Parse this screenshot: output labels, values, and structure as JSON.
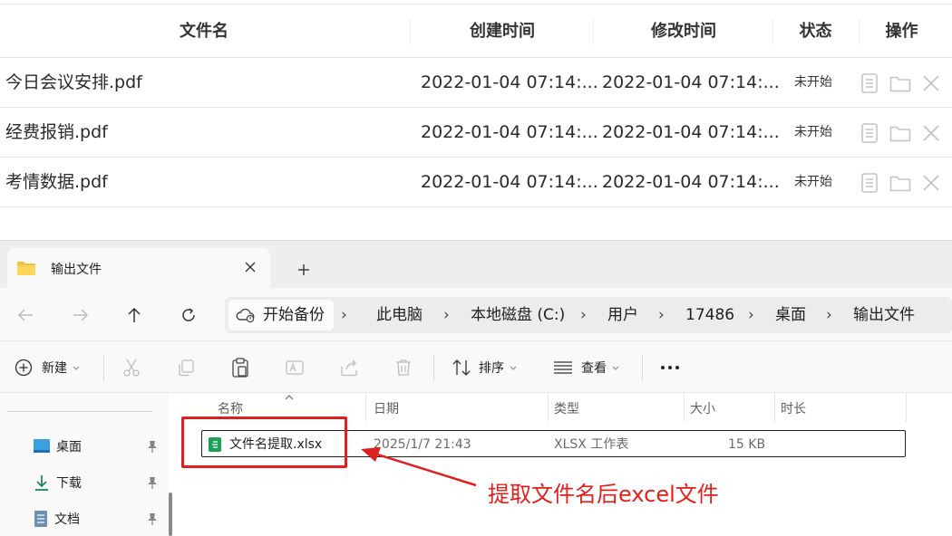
{
  "table": {
    "headers": {
      "name": "文件名",
      "created": "创建时间",
      "modified": "修改时间",
      "status": "状态",
      "actions": "操作"
    },
    "rows": [
      {
        "name": "今日会议安排.pdf",
        "created": "2022-01-04 07:14:...",
        "modified": "2022-01-04 07:14:...",
        "status": "未开始"
      },
      {
        "name": "经费报销.pdf",
        "created": "2022-01-04 07:14:...",
        "modified": "2022-01-04 07:14:...",
        "status": "未开始"
      },
      {
        "name": "考情数据.pdf",
        "created": "2022-01-04 07:14:...",
        "modified": "2022-01-04 07:14:...",
        "status": "未开始"
      }
    ]
  },
  "explorer": {
    "tab_title": "输出文件",
    "breadcrumb": {
      "home": "开始备份",
      "items": [
        "此电脑",
        "本地磁盘 (C:)",
        "用户",
        "17486",
        "桌面",
        "输出文件"
      ]
    },
    "toolbar": {
      "new_label": "新建",
      "sort_label": "排序",
      "view_label": "查看"
    },
    "sidebar": {
      "items": [
        "桌面",
        "下载",
        "文档"
      ]
    },
    "columns": {
      "name": "名称",
      "date": "日期",
      "type": "类型",
      "size": "大小",
      "duration": "时长"
    },
    "file": {
      "name": "文件名提取.xlsx",
      "date": "2025/1/7 21:43",
      "type": "XLSX 工作表",
      "size": "15 KB"
    }
  },
  "annotation": {
    "text": "提取文件名后excel文件",
    "color": "#e0201c"
  }
}
